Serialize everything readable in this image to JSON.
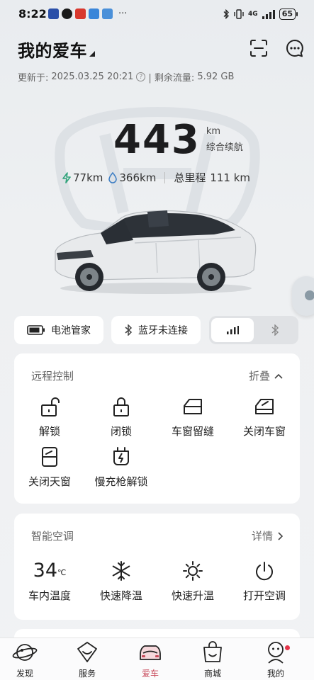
{
  "status_bar": {
    "time": "8:22",
    "more": "···",
    "network": "4G",
    "battery": "65"
  },
  "header": {
    "title": "我的爱车",
    "update_prefix": "更新于:",
    "update_time": "2025.03.25 20:21",
    "data_separator": "| 剩余流量:",
    "data_remaining": "5.92 GB"
  },
  "vehicle": {
    "range_value": "443",
    "range_unit": "km",
    "range_label": "综合续航",
    "electric_range": "77km",
    "fuel_range": "366km",
    "odometer_label": "总里程",
    "odometer_value": "111 km"
  },
  "quick_actions": {
    "battery_manager": "电池管家",
    "bluetooth_status": "蓝牙未连接"
  },
  "remote_control": {
    "title": "远程控制",
    "collapse": "折叠",
    "items": [
      {
        "label": "解锁",
        "icon": "unlock-icon"
      },
      {
        "label": "闭锁",
        "icon": "lock-icon"
      },
      {
        "label": "车窗留缝",
        "icon": "window-vent-icon"
      },
      {
        "label": "关闭车窗",
        "icon": "window-close-icon"
      },
      {
        "label": "关闭天窗",
        "icon": "sunroof-close-icon"
      },
      {
        "label": "慢充枪解锁",
        "icon": "charger-unlock-icon"
      }
    ]
  },
  "climate": {
    "title": "智能空调",
    "details": "详情",
    "temperature": "34",
    "temperature_unit": "℃",
    "items": [
      {
        "label": "车内温度"
      },
      {
        "label": "快速降温",
        "icon": "snowflake-icon"
      },
      {
        "label": "快速升温",
        "icon": "sun-icon"
      },
      {
        "label": "打开空调",
        "icon": "power-icon"
      }
    ]
  },
  "nav": {
    "items": [
      {
        "label": "发现",
        "icon": "planet-icon"
      },
      {
        "label": "服务",
        "icon": "service-icon"
      },
      {
        "label": "爱车",
        "icon": "car-icon"
      },
      {
        "label": "商城",
        "icon": "shop-bag-icon"
      },
      {
        "label": "我的",
        "icon": "profile-icon"
      }
    ],
    "active": "爱车"
  },
  "colors": {
    "accent": "#c8495a",
    "electric": "#2fa37a",
    "fuel": "#3f7fc4"
  }
}
